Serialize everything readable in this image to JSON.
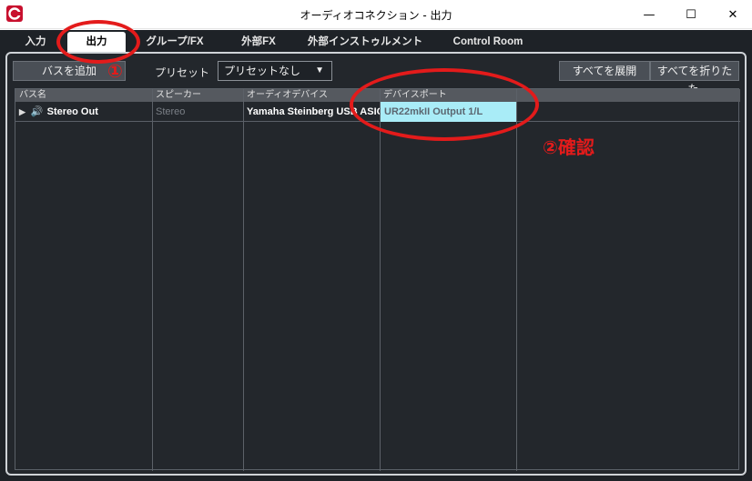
{
  "window": {
    "title": "オーディオコネクション - 出力",
    "minimize_glyph": "—",
    "maximize_glyph": "☐",
    "close_glyph": "✕",
    "app_icon": "cubase-logo-icon"
  },
  "tabs": [
    {
      "label": "入力",
      "active": false
    },
    {
      "label": "出力",
      "active": true
    },
    {
      "label": "グループ/FX",
      "active": false
    },
    {
      "label": "外部FX",
      "active": false
    },
    {
      "label": "外部インストゥルメント",
      "active": false
    },
    {
      "label": "Control Room",
      "active": false
    }
  ],
  "toolbar": {
    "add_bus_label": "バスを追加",
    "preset_label": "プリセット",
    "preset_value": "プリセットなし",
    "expand_all_label": "すべてを展開",
    "collapse_all_label": "すべてを折りたた."
  },
  "table": {
    "columns": [
      "バス名",
      "スピーカー",
      "オーディオデバイス",
      "デバイスポート"
    ],
    "rows": [
      {
        "bus_name": "Stereo Out",
        "speaker": "Stereo",
        "audio_device": "Yamaha Steinberg USB ASIO",
        "device_port": "UR22mkII Output 1/L"
      }
    ]
  },
  "annotations": {
    "step1": "①",
    "step2": "②確認"
  },
  "colors": {
    "annotation_red": "#e31b1b",
    "highlight_cyan": "#a9ecf7",
    "brand_red": "#c8102e"
  }
}
